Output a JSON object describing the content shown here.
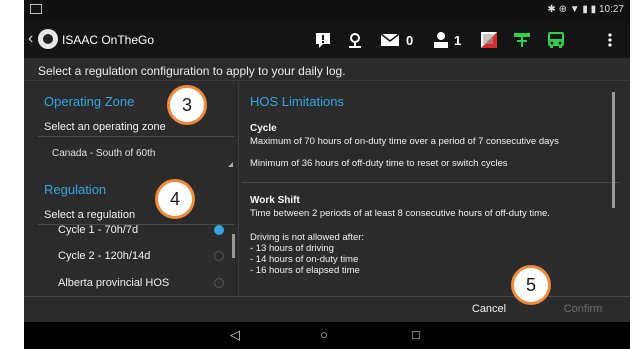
{
  "status_bar": {
    "time": "10:27",
    "indicators": "✱ ⊕ ▼ ▮ ▮"
  },
  "app": {
    "title": "ISAAC OnTheGo",
    "back_icon": "‹",
    "mail_count": "0",
    "people_count": "1"
  },
  "instruction": "Select a regulation configuration to apply to your daily log.",
  "operating_zone": {
    "title": "Operating Zone",
    "label": "Select an operating zone",
    "value": "Canada - South of 60th"
  },
  "regulation": {
    "title": "Regulation",
    "label": "Select a regulation",
    "items": [
      {
        "label": "Cycle 1 - 70h/7d",
        "selected": true
      },
      {
        "label": "Cycle 2 - 120h/14d",
        "selected": false
      },
      {
        "label": "Alberta provincial HOS",
        "selected": false
      }
    ]
  },
  "hos": {
    "title": "HOS Limitations",
    "cycle": {
      "heading": "Cycle",
      "line1": "Maximum of 70 hours of on-duty time over a period of 7 consecutive days",
      "line2": "Minimum of 36 hours of off-duty time to reset or switch cycles"
    },
    "work_shift": {
      "heading": "Work Shift",
      "line1": "Time between 2 periods of at least 8 consecutive hours of off-duty time.",
      "line2": "Driving is not allowed after:",
      "line3": "- 13 hours of driving",
      "line4": "- 14 hours of on-duty time",
      "line5": "- 16 hours of elapsed time"
    }
  },
  "buttons": {
    "cancel": "Cancel",
    "confirm": "Confirm"
  },
  "nav": {
    "back": "◁",
    "home": "○",
    "recents": "□"
  },
  "callouts": [
    "3",
    "4",
    "5"
  ],
  "colors": {
    "accent": "#33a5e0",
    "callout_border": "#f08a3c",
    "green_icon": "#2ed14a"
  }
}
